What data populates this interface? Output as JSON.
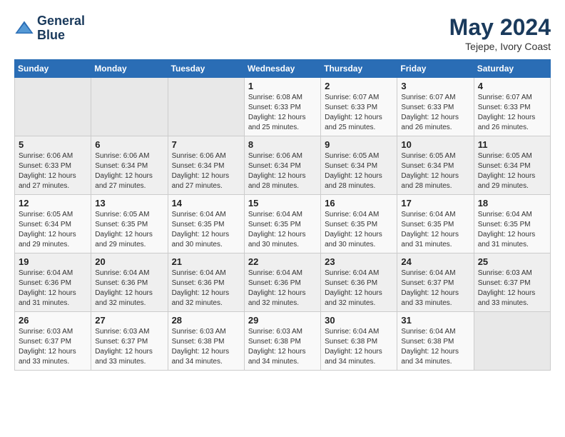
{
  "logo": {
    "line1": "General",
    "line2": "Blue"
  },
  "title": "May 2024",
  "location": "Tejepe, Ivory Coast",
  "headers": [
    "Sunday",
    "Monday",
    "Tuesday",
    "Wednesday",
    "Thursday",
    "Friday",
    "Saturday"
  ],
  "weeks": [
    [
      {
        "day": "",
        "info": ""
      },
      {
        "day": "",
        "info": ""
      },
      {
        "day": "",
        "info": ""
      },
      {
        "day": "1",
        "info": "Sunrise: 6:08 AM\nSunset: 6:33 PM\nDaylight: 12 hours\nand 25 minutes."
      },
      {
        "day": "2",
        "info": "Sunrise: 6:07 AM\nSunset: 6:33 PM\nDaylight: 12 hours\nand 25 minutes."
      },
      {
        "day": "3",
        "info": "Sunrise: 6:07 AM\nSunset: 6:33 PM\nDaylight: 12 hours\nand 26 minutes."
      },
      {
        "day": "4",
        "info": "Sunrise: 6:07 AM\nSunset: 6:33 PM\nDaylight: 12 hours\nand 26 minutes."
      }
    ],
    [
      {
        "day": "5",
        "info": "Sunrise: 6:06 AM\nSunset: 6:33 PM\nDaylight: 12 hours\nand 27 minutes."
      },
      {
        "day": "6",
        "info": "Sunrise: 6:06 AM\nSunset: 6:34 PM\nDaylight: 12 hours\nand 27 minutes."
      },
      {
        "day": "7",
        "info": "Sunrise: 6:06 AM\nSunset: 6:34 PM\nDaylight: 12 hours\nand 27 minutes."
      },
      {
        "day": "8",
        "info": "Sunrise: 6:06 AM\nSunset: 6:34 PM\nDaylight: 12 hours\nand 28 minutes."
      },
      {
        "day": "9",
        "info": "Sunrise: 6:05 AM\nSunset: 6:34 PM\nDaylight: 12 hours\nand 28 minutes."
      },
      {
        "day": "10",
        "info": "Sunrise: 6:05 AM\nSunset: 6:34 PM\nDaylight: 12 hours\nand 28 minutes."
      },
      {
        "day": "11",
        "info": "Sunrise: 6:05 AM\nSunset: 6:34 PM\nDaylight: 12 hours\nand 29 minutes."
      }
    ],
    [
      {
        "day": "12",
        "info": "Sunrise: 6:05 AM\nSunset: 6:34 PM\nDaylight: 12 hours\nand 29 minutes."
      },
      {
        "day": "13",
        "info": "Sunrise: 6:05 AM\nSunset: 6:35 PM\nDaylight: 12 hours\nand 29 minutes."
      },
      {
        "day": "14",
        "info": "Sunrise: 6:04 AM\nSunset: 6:35 PM\nDaylight: 12 hours\nand 30 minutes."
      },
      {
        "day": "15",
        "info": "Sunrise: 6:04 AM\nSunset: 6:35 PM\nDaylight: 12 hours\nand 30 minutes."
      },
      {
        "day": "16",
        "info": "Sunrise: 6:04 AM\nSunset: 6:35 PM\nDaylight: 12 hours\nand 30 minutes."
      },
      {
        "day": "17",
        "info": "Sunrise: 6:04 AM\nSunset: 6:35 PM\nDaylight: 12 hours\nand 31 minutes."
      },
      {
        "day": "18",
        "info": "Sunrise: 6:04 AM\nSunset: 6:35 PM\nDaylight: 12 hours\nand 31 minutes."
      }
    ],
    [
      {
        "day": "19",
        "info": "Sunrise: 6:04 AM\nSunset: 6:36 PM\nDaylight: 12 hours\nand 31 minutes."
      },
      {
        "day": "20",
        "info": "Sunrise: 6:04 AM\nSunset: 6:36 PM\nDaylight: 12 hours\nand 32 minutes."
      },
      {
        "day": "21",
        "info": "Sunrise: 6:04 AM\nSunset: 6:36 PM\nDaylight: 12 hours\nand 32 minutes."
      },
      {
        "day": "22",
        "info": "Sunrise: 6:04 AM\nSunset: 6:36 PM\nDaylight: 12 hours\nand 32 minutes."
      },
      {
        "day": "23",
        "info": "Sunrise: 6:04 AM\nSunset: 6:36 PM\nDaylight: 12 hours\nand 32 minutes."
      },
      {
        "day": "24",
        "info": "Sunrise: 6:04 AM\nSunset: 6:37 PM\nDaylight: 12 hours\nand 33 minutes."
      },
      {
        "day": "25",
        "info": "Sunrise: 6:03 AM\nSunset: 6:37 PM\nDaylight: 12 hours\nand 33 minutes."
      }
    ],
    [
      {
        "day": "26",
        "info": "Sunrise: 6:03 AM\nSunset: 6:37 PM\nDaylight: 12 hours\nand 33 minutes."
      },
      {
        "day": "27",
        "info": "Sunrise: 6:03 AM\nSunset: 6:37 PM\nDaylight: 12 hours\nand 33 minutes."
      },
      {
        "day": "28",
        "info": "Sunrise: 6:03 AM\nSunset: 6:38 PM\nDaylight: 12 hours\nand 34 minutes."
      },
      {
        "day": "29",
        "info": "Sunrise: 6:03 AM\nSunset: 6:38 PM\nDaylight: 12 hours\nand 34 minutes."
      },
      {
        "day": "30",
        "info": "Sunrise: 6:04 AM\nSunset: 6:38 PM\nDaylight: 12 hours\nand 34 minutes."
      },
      {
        "day": "31",
        "info": "Sunrise: 6:04 AM\nSunset: 6:38 PM\nDaylight: 12 hours\nand 34 minutes."
      },
      {
        "day": "",
        "info": ""
      }
    ]
  ]
}
